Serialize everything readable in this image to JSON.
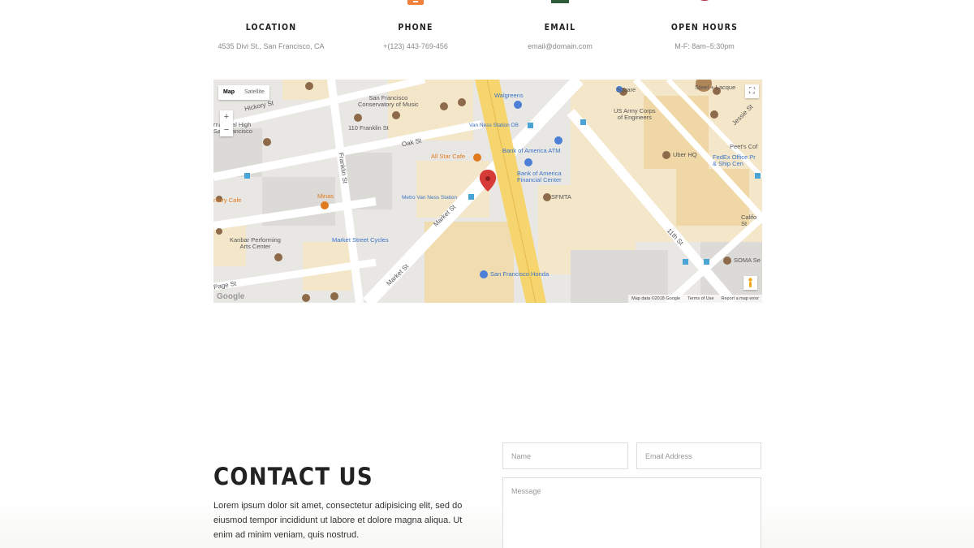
{
  "info": [
    {
      "title": "LOCATION",
      "value": "4535 Divi St., San Francisco, CA",
      "icon": "map-pin-icon",
      "color": "#1f6f78"
    },
    {
      "title": "PHONE",
      "value": "+(123) 443-769-456",
      "icon": "phone-icon",
      "color": "#f07f3c"
    },
    {
      "title": "EMAIL",
      "value": "email@domain.com",
      "icon": "envelope-icon",
      "color": "#2f5d3a"
    },
    {
      "title": "OPEN HOURS",
      "value": "M-F: 8am–5:30pm",
      "icon": "clock-icon",
      "color": "#a83245"
    }
  ],
  "map": {
    "type_map": "Map",
    "type_satellite": "Satellite",
    "zoom_in": "+",
    "zoom_out": "−",
    "footer": {
      "data": "Map data ©2018 Google",
      "terms": "Terms of Use",
      "report": "Report a map error"
    },
    "logo": "Google",
    "labels": {
      "hickory": "Hickory St",
      "sf_conservatory": "San Francisco\nConservatory of Music",
      "franklin_110": "110 Franklin St",
      "intl_high": "rnational High\nSan Francisco",
      "oak": "Oak St",
      "franklin": "Franklin St",
      "all_star": "All Star Cafe",
      "van_ness_station": "Van Ness Station OB",
      "walgreens": "Walgreens",
      "boa_atm": "Bank of America ATM",
      "boa_center": "Bank of America\nFinancial Center",
      "sfmta": "SFMTA",
      "metro_van_ness": "Metro Van Ness Station",
      "minas": "Minas",
      "ntury_cafe": "ntury Cafe",
      "market_1": "Market St",
      "market_2": "Market St",
      "kanbar": "Kanbar Performing\nArts Center",
      "market_cycles": "Market Street Cycles",
      "page": "Page St",
      "sf_honda": "San Francisco Honda",
      "square": "Square",
      "army_corps": "US Army Corps\nof Engineers",
      "uber": "Uber HQ",
      "steel": "Steel + Lacque",
      "jessie": "Jessie St",
      "peets": "Peet's Cof",
      "fedex": "FedEx Office Pr\n& Ship Cen",
      "eleventh": "11th St",
      "califo": "Califo\nSt",
      "soma": "SOMA Se"
    }
  },
  "contact": {
    "title": "CONTACT US",
    "text": "Lorem ipsum dolor sit amet, consectetur adipisicing elit, sed do eiusmod tempor incididunt ut labore et dolore magna aliqua. Ut enim ad minim veniam, quis nostrud.",
    "name_placeholder": "Name",
    "email_placeholder": "Email Address",
    "message_placeholder": "Message"
  }
}
